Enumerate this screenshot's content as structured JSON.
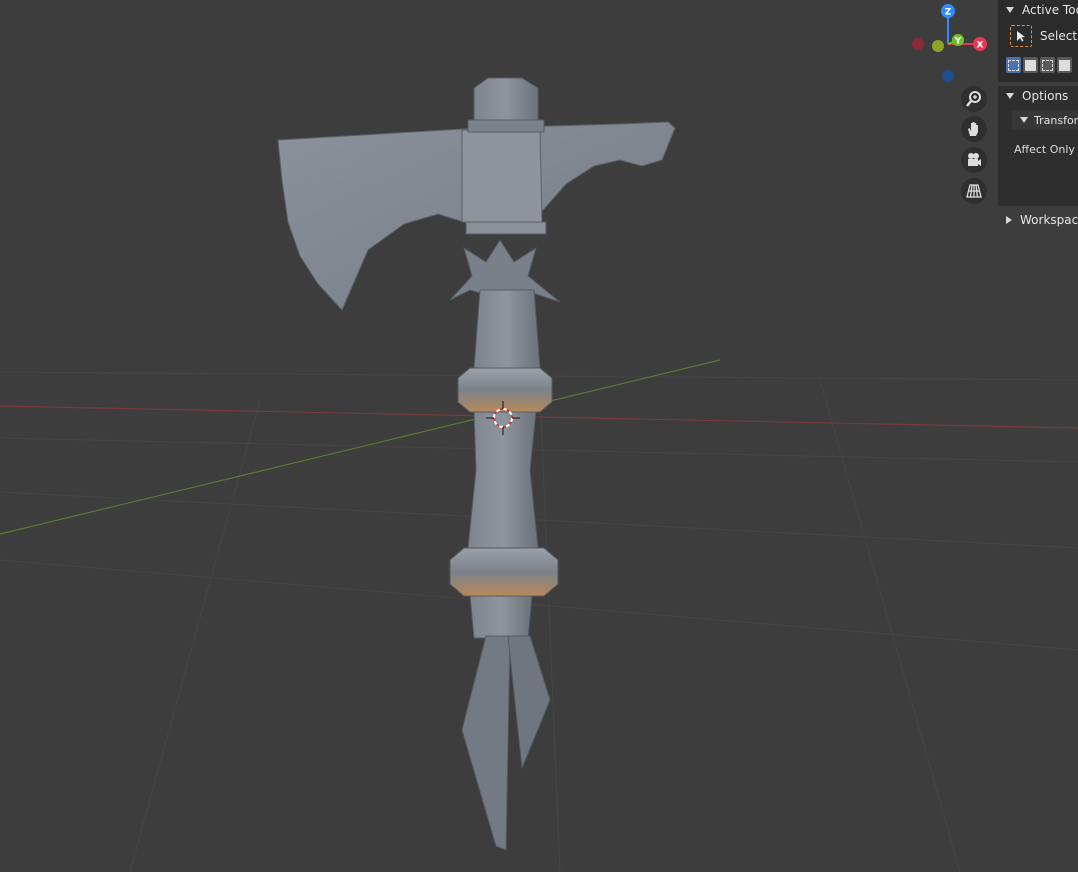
{
  "viewport": {
    "gizmo": {
      "z_label": "Z",
      "x_label": "X",
      "y_label": "Y"
    },
    "nav_buttons": [
      {
        "name": "zoom-icon",
        "glyph": "zoom"
      },
      {
        "name": "hand-pan-icon",
        "glyph": "hand"
      },
      {
        "name": "camera-icon",
        "glyph": "camera"
      },
      {
        "name": "grid-perspective-icon",
        "glyph": "grid"
      }
    ]
  },
  "panel": {
    "active_tool_title": "Active Tool",
    "select_label": "Select Box",
    "options_title": "Options",
    "transform_title": "Transform",
    "affect_only_label": "Affect Only",
    "workspace_title": "Workspace"
  },
  "colors": {
    "viewport_bg": "#3d3d3d",
    "panel_bg": "#2b2b2b",
    "x_axis": "#e8384f",
    "y_axis": "#6fbf2a",
    "z_axis": "#2f8cff",
    "accent": "#4772b3",
    "select_outline": "#e0903a"
  }
}
